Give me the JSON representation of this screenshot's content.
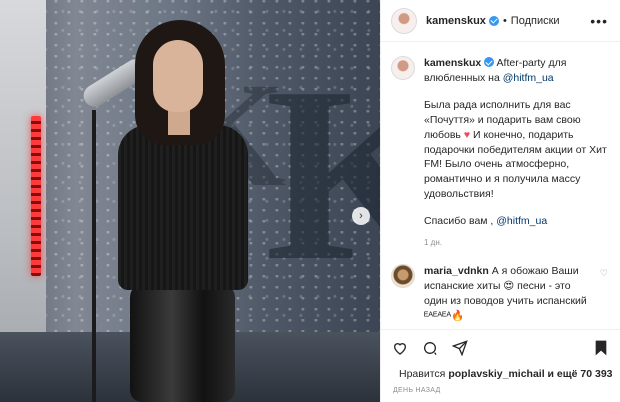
{
  "post": {
    "image_alt": "",
    "next_icon": "chevron-right-icon"
  },
  "header": {
    "username": "kamenskux",
    "separator": "•",
    "follow_label": "Подписки",
    "more_icon": "more-horizontal-icon",
    "more_label": "•••"
  },
  "caption": {
    "username": "kamenskux",
    "intro": "After-party для влюбленных на ",
    "mention": "@hitfm_ua",
    "text_1": "Была рада исполнить для вас «Почуття» и подарить вам свою любовь ",
    "heart": "♥",
    "text_2": " И конечно, подарить подарочки победителям акции от Хит FM! Было очень атмосферно, романтично и я получила массу удовольствия!",
    "thanks": "Спасибо вам , ",
    "thanks_mention": "@hitfm_ua",
    "time": "1 дн."
  },
  "comment": {
    "username": "maria_vdnkn",
    "text": "А я обожаю Ваши испанские хиты 😍 песни - это один из поводов учить испанский ᴱᴬᴱᴬᴱᴬ🔥",
    "like_icon": "heart-outline-icon",
    "like_symbol": "♡"
  },
  "actions": {
    "like_icon": "heart-outline-icon",
    "comment_icon": "comment-icon",
    "share_icon": "share-icon",
    "save_icon": "bookmark-icon"
  },
  "likes": {
    "prefix": "Нравится ",
    "user": "poplavskiy_michail",
    "suffix": " и ещё 70 393"
  },
  "timestamp": "ДЕНЬ НАЗАД",
  "colors": {
    "link": "#00376b",
    "verified": "#3897f0",
    "heart": "#ed4956"
  }
}
